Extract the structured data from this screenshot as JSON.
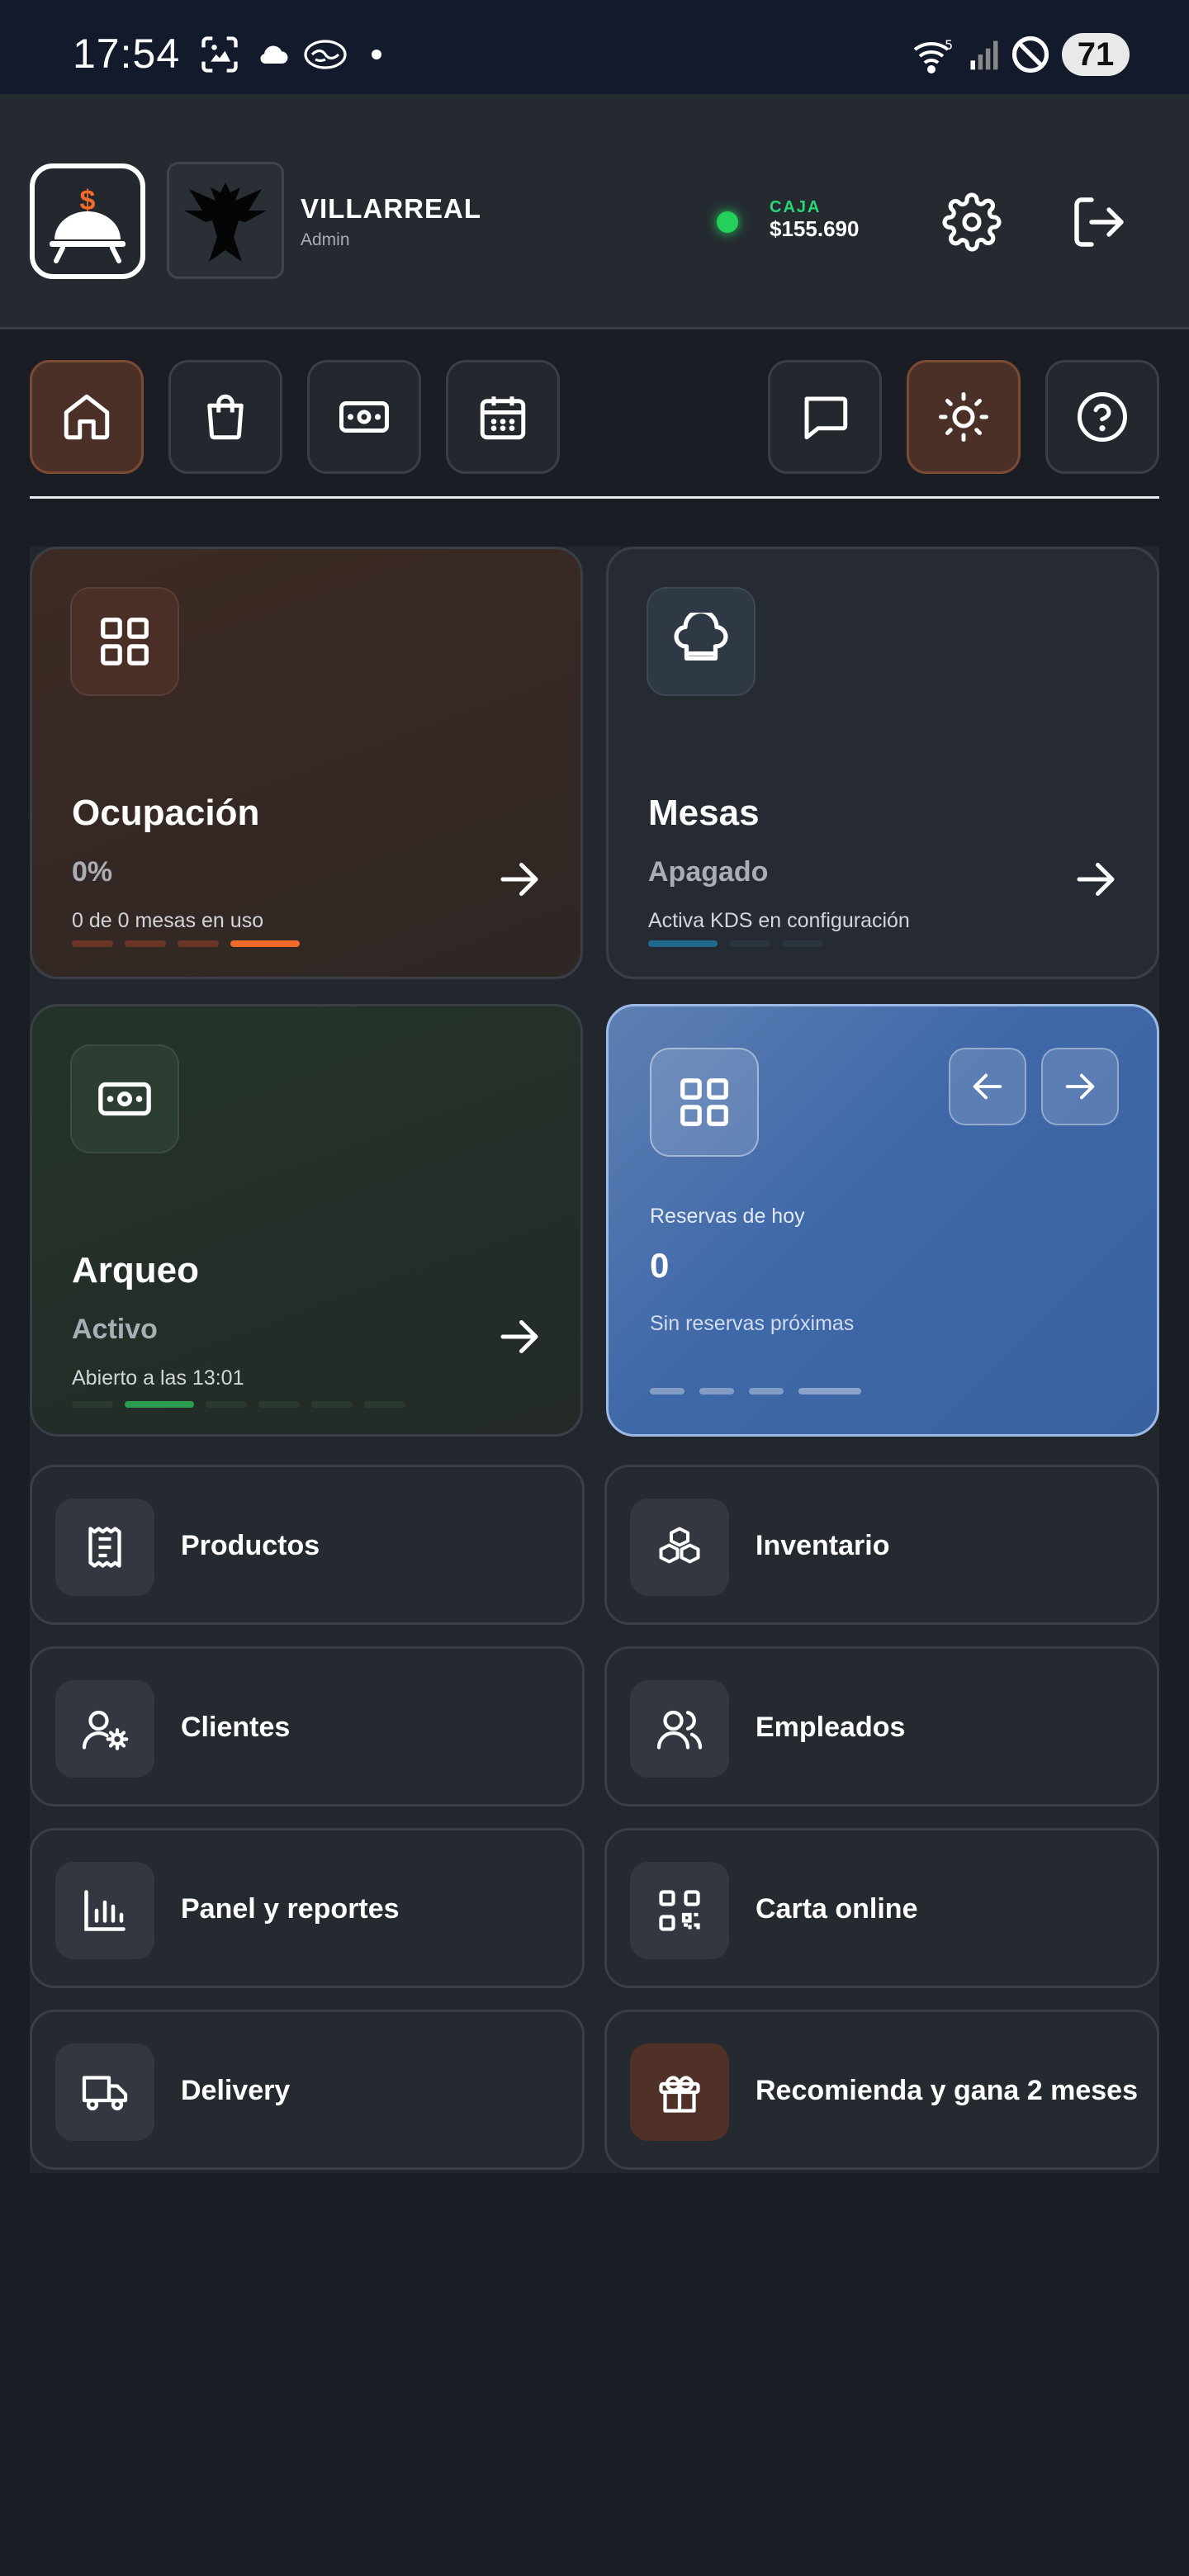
{
  "status_bar": {
    "time": "17:54",
    "battery": "71",
    "icons": [
      "gallery-icon",
      "cloud-icon",
      "handshake-icon",
      "dot-icon",
      "wifi-icon",
      "signal-icon",
      "dnd-icon"
    ]
  },
  "header": {
    "user_name": "VILLARREAL",
    "user_role": "Admin",
    "caja_label": "CAJA",
    "caja_value": "$155.690",
    "caja_status_color": "#22d05a",
    "logo_icon": "restaurant-cloche-icon",
    "avatar_icon": "black-eagle-avatar"
  },
  "nav": {
    "left": [
      {
        "icon": "home-icon",
        "active": true
      },
      {
        "icon": "shopping-bag-icon",
        "active": false
      },
      {
        "icon": "cash-icon",
        "active": false
      },
      {
        "icon": "calendar-icon",
        "active": false
      }
    ],
    "right": [
      {
        "icon": "chat-icon",
        "active": false
      },
      {
        "icon": "sun-icon",
        "active": true
      },
      {
        "icon": "help-icon",
        "active": false
      }
    ]
  },
  "cards": {
    "ocupacion": {
      "title": "Ocupación",
      "value": "0%",
      "desc": "0 de 0 mesas en uso",
      "active_segment": 4
    },
    "mesas": {
      "title": "Mesas",
      "value": "Apagado",
      "desc": "Activa KDS en configuración",
      "active_segment": 1
    },
    "arqueo": {
      "title": "Arqueo",
      "value": "Activo",
      "desc": "Abierto a las 13:01",
      "active_segment": 2
    },
    "reservas": {
      "label": "Reservas de hoy",
      "count": "0",
      "desc": "Sin reservas próximas"
    }
  },
  "menu": [
    {
      "label": "Productos",
      "icon": "receipt-icon"
    },
    {
      "label": "Inventario",
      "icon": "boxes-icon"
    },
    {
      "label": "Clientes",
      "icon": "user-settings-icon"
    },
    {
      "label": "Empleados",
      "icon": "users-icon"
    },
    {
      "label": "Panel y reportes",
      "icon": "bar-chart-icon"
    },
    {
      "label": "Carta online",
      "icon": "qr-code-icon"
    },
    {
      "label": "Delivery",
      "icon": "truck-icon"
    },
    {
      "label": "Recomienda y gana 2 meses",
      "icon": "gift-icon"
    }
  ],
  "colors": {
    "accent_orange": "#f26b2a",
    "accent_green": "#2a9d4f",
    "accent_blue": "#1e6a8f",
    "reservas_blue": "#3c63a3"
  }
}
